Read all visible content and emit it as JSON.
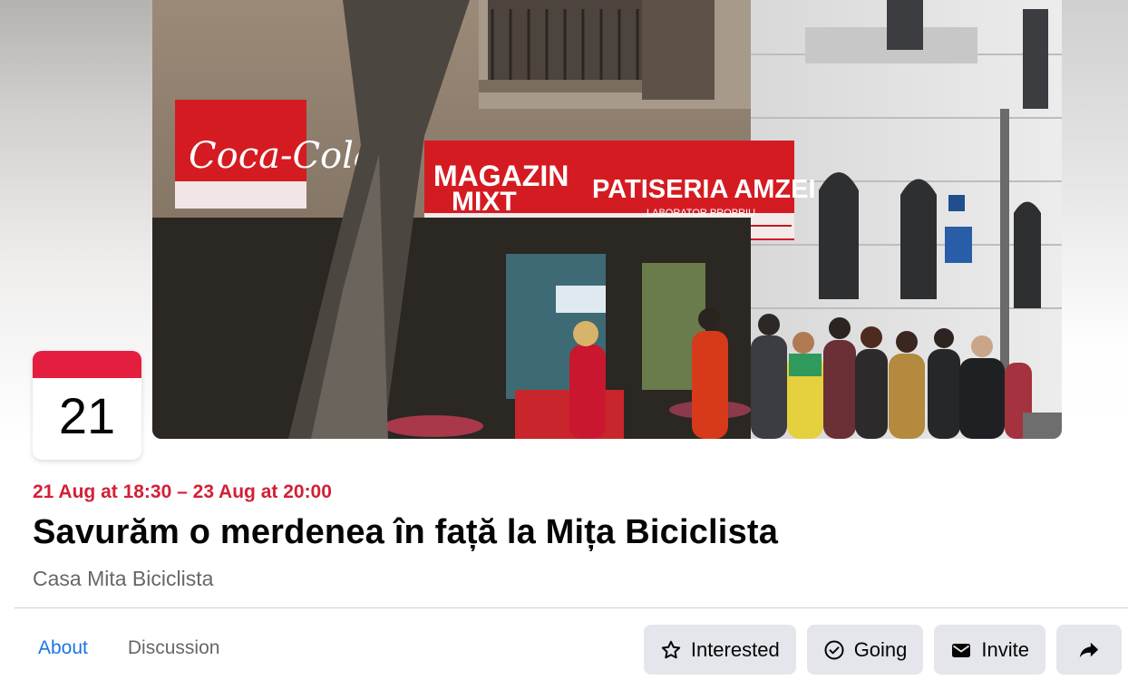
{
  "calendar": {
    "day": "21"
  },
  "event": {
    "date_range": "21 Aug at 18:30 – 23 Aug at 20:00",
    "title": "Savurăm o merdenea în față la Mița Biciclista",
    "host": "Casa Mita Biciclista"
  },
  "cover_signs": {
    "sign1": "Coca-Cola",
    "sign2_line1": "MAGAZIN",
    "sign2_line2": "MIXT",
    "sign3": "PATISERIA AMZEI",
    "sign3_sub": "LABORATOR PROPRIU"
  },
  "tabs": [
    {
      "label": "About",
      "active": true
    },
    {
      "label": "Discussion",
      "active": false
    }
  ],
  "actions": {
    "interested": "Interested",
    "going": "Going",
    "invite": "Invite"
  },
  "colors": {
    "accent_red": "#e41e3f",
    "date_red": "#d31f35",
    "link_blue": "#1b74e4",
    "button_gray": "#e4e6eb"
  },
  "icons": [
    "star-icon",
    "check-circle-icon",
    "envelope-icon",
    "share-arrow-icon"
  ]
}
